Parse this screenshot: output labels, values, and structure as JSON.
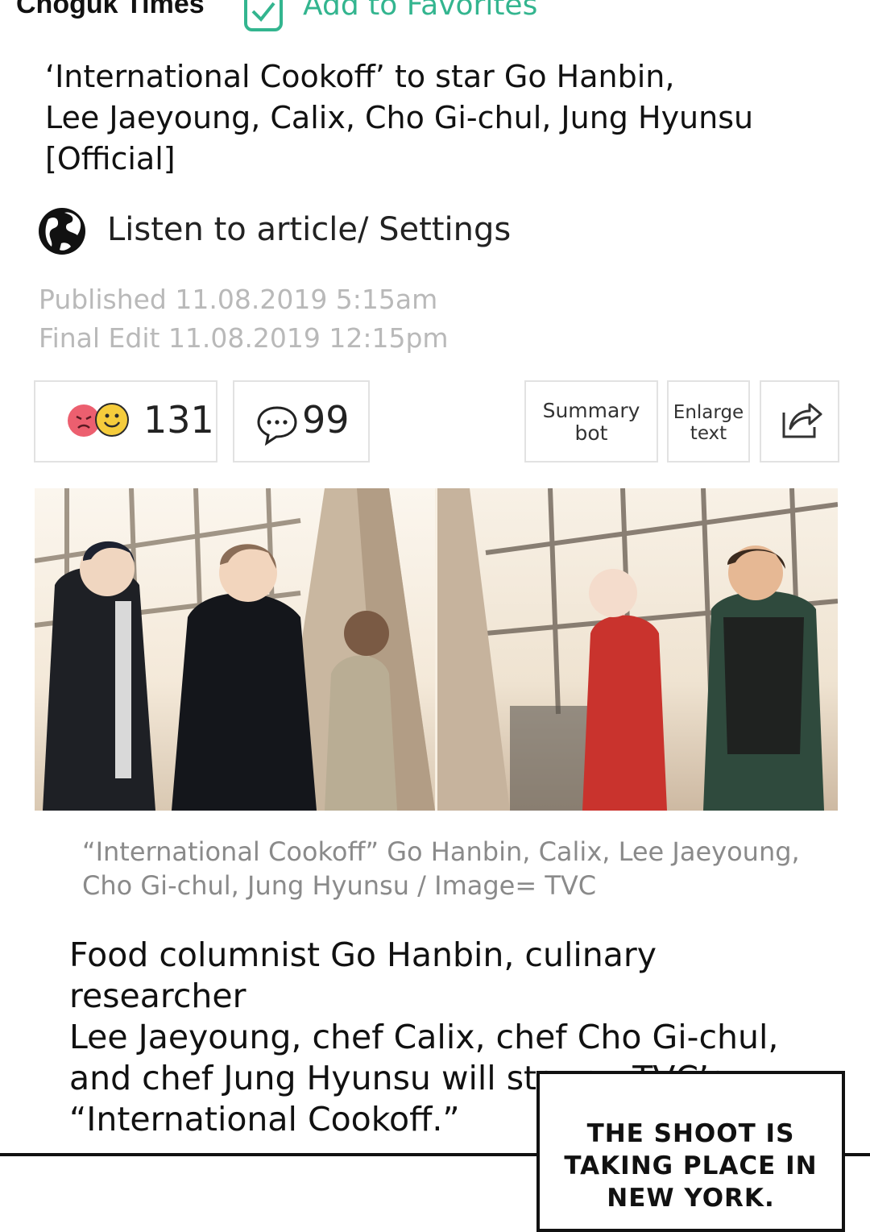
{
  "header": {
    "brand": "Choguk Times",
    "favorite_label": "Add to Favorites"
  },
  "article": {
    "headline_lines": [
      "‘International Cookoff’ to star Go Hanbin,",
      "Lee Jaeyoung, Calix, Cho Gi-chul, Jung Hyunsu",
      "[Official]"
    ],
    "listen_label": "Listen to article/ Settings",
    "published": "Published 11.08.2019 5:15am",
    "final_edit": "Final Edit 11.08.2019 12:15pm",
    "reactions_count": "131",
    "comments_count": "99",
    "summary_label": [
      "Summary",
      "bot"
    ],
    "enlarge_label": [
      "Enlarge",
      "text"
    ],
    "caption_lines": [
      "“International Cookoff” Go Hanbin, Calix, Lee Jaeyoung,",
      "Cho Gi-chul, Jung Hyunsu / Image= TVC"
    ],
    "body_lines": [
      "Food columnist Go Hanbin, culinary researcher",
      "Lee Jaeyoung, chef Calix, chef Cho Gi-chul,",
      "and chef Jung Hyunsu will star on TVC’s",
      "“International Cookoff.”"
    ]
  },
  "comic_box": {
    "lines": [
      "THE SHOOT IS",
      "TAKING PLACE IN",
      "NEW YORK."
    ]
  },
  "colors": {
    "accent_green": "#33b58f",
    "meta_gray": "#b9b9b9",
    "caption_gray": "#8a8a8a"
  },
  "icons": [
    "check-box-icon",
    "globe-icon",
    "angry-emoji-icon",
    "smile-emoji-icon",
    "comment-bubble-icon",
    "share-icon"
  ]
}
